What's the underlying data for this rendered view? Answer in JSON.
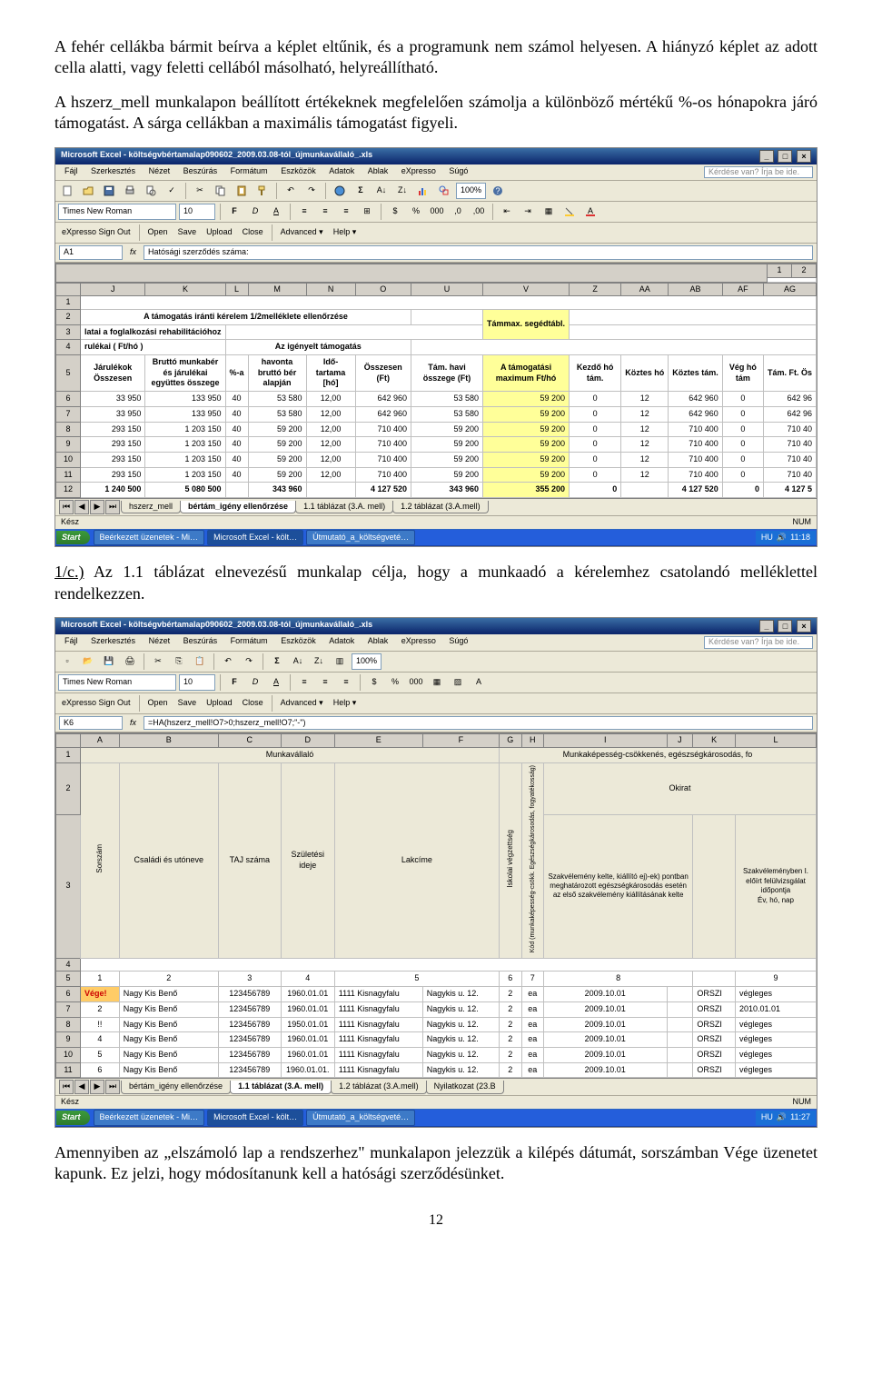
{
  "para1": "A fehér cellákba bármit beírva a képlet eltűnik, és a programunk nem számol helyesen. A hiányzó képlet az adott cella alatti, vagy feletti cellából másolható, helyreállítható.",
  "para2": "A hszerz_mell munkalapon beállított értékeknek megfelelően számolja a különböző mértékű %-os hónapokra járó támogatást. A sárga cellákban a maximális támogatást figyeli.",
  "para3_prefix": "1/c.)",
  "para3_rest": " Az 1.1 táblázat elnevezésű munkalap célja, hogy a munkaadó a kérelemhez csatolandó melléklettel rendelkezzen.",
  "para4": "Amennyiben az „elszámoló lap a rendszerhez\" munkalapon jelezzük a kilépés dátumát, sorszámban Vége üzenetet kapunk. Ez jelzi, hogy módosítanunk kell a hatósági szerződésünket.",
  "pageNum": "12",
  "ex1": {
    "title": "Microsoft Excel - költségvbértamalap090602_2009.03.08-tól_újmunkavállaló_.xls",
    "helpHint": "Kérdése van? Írja be ide.",
    "menus": [
      "Fájl",
      "Szerkesztés",
      "Nézet",
      "Beszúrás",
      "Formátum",
      "Eszközök",
      "Adatok",
      "Ablak",
      "eXpresso",
      "Súgó"
    ],
    "font": "Times New Roman",
    "fontSize": "10",
    "zoom": "100%",
    "expresso": [
      "eXpresso Sign Out",
      "Open",
      "Save",
      "Upload",
      "Close",
      "Advanced ▾",
      "Help ▾"
    ],
    "nameBox": "A1",
    "formula": "Hatósági szerződés száma:",
    "cols": [
      "J",
      "K",
      "L",
      "M",
      "N",
      "O",
      "U",
      "V",
      "Z",
      "AA",
      "AB",
      "AF",
      "AG"
    ],
    "titleRow": "A támogatás iránti kérelem 1/2melléklete ellenőrzése",
    "hdrL1": "latai a foglalkozási rehabilitációhoz",
    "yellowBox1": "Támmax. segédtábl.",
    "hdrL2": "rulékai ( Ft/hó )",
    "hdrL2r": "Az igényelt támogatás",
    "h5": [
      "Járulékok Összesen",
      "Bruttó munkabér és járulékai együttes összege",
      "%-a",
      "havonta bruttó bér alapján",
      "Idő- tartama [hó]",
      "Összesen (Ft)",
      "Tám. havi összege (Ft)",
      "A támogatási maximum Ft/hó",
      "Kezdő hó tám.",
      "Köztes hó",
      "Köztes tám.",
      "Vég hó tám",
      "Tám. Ft. Ös"
    ],
    "rows": [
      [
        "33 950",
        "133 950",
        "40",
        "53 580",
        "12,00",
        "642 960",
        "53 580",
        "59 200",
        "0",
        "12",
        "642 960",
        "0",
        "642 96"
      ],
      [
        "33 950",
        "133 950",
        "40",
        "53 580",
        "12,00",
        "642 960",
        "53 580",
        "59 200",
        "0",
        "12",
        "642 960",
        "0",
        "642 96"
      ],
      [
        "293 150",
        "1 203 150",
        "40",
        "59 200",
        "12,00",
        "710 400",
        "59 200",
        "59 200",
        "0",
        "12",
        "710 400",
        "0",
        "710 40"
      ],
      [
        "293 150",
        "1 203 150",
        "40",
        "59 200",
        "12,00",
        "710 400",
        "59 200",
        "59 200",
        "0",
        "12",
        "710 400",
        "0",
        "710 40"
      ],
      [
        "293 150",
        "1 203 150",
        "40",
        "59 200",
        "12,00",
        "710 400",
        "59 200",
        "59 200",
        "0",
        "12",
        "710 400",
        "0",
        "710 40"
      ],
      [
        "293 150",
        "1 203 150",
        "40",
        "59 200",
        "12,00",
        "710 400",
        "59 200",
        "59 200",
        "0",
        "12",
        "710 400",
        "0",
        "710 40"
      ]
    ],
    "sumRow": [
      "1 240 500",
      "5 080 500",
      "",
      "343 960",
      "",
      "4 127 520",
      "343 960",
      "355 200",
      "0",
      "",
      "4 127 520",
      "0",
      "4 127 5"
    ],
    "tabs": [
      "hszerz_mell",
      "bértám_igény ellenőrzése",
      "1.1 táblázat (3.A. mell)",
      "1.2 táblázat (3.A.mell)"
    ],
    "activeTab": 1,
    "status": "Kész",
    "statusRight": "NUM",
    "taskbar": {
      "tasks": [
        "Beérkezett üzenetek - Mi…",
        "Microsoft Excel - költ…",
        "Útmutató_a_költségveté…"
      ],
      "time": "11:18",
      "lang": "HU"
    }
  },
  "ex2": {
    "title": "Microsoft Excel - költségvbértamalap090602_2009.03.08-tól_újmunkavállaló_.xls",
    "helpHint": "Kérdése van? Írja be ide.",
    "menus": [
      "Fájl",
      "Szerkesztés",
      "Nézet",
      "Beszúrás",
      "Formátum",
      "Eszközök",
      "Adatok",
      "Ablak",
      "eXpresso",
      "Súgó"
    ],
    "font": "Times New Roman",
    "fontSize": "10",
    "zoom": "100%",
    "expresso": [
      "eXpresso Sign Out",
      "Open",
      "Save",
      "Upload",
      "Close",
      "Advanced ▾",
      "Help ▾"
    ],
    "nameBox": "K6",
    "formula": "=HA(hszerz_mell!O7>0;hszerz_mell!O7;\"-\")",
    "cols": [
      "A",
      "B",
      "C",
      "D",
      "E",
      "F",
      "G",
      "H",
      "I",
      "J",
      "K",
      "L"
    ],
    "merge1a": "Munkavállaló",
    "merge1b": "Munkaképesség-csökkenés, egészségkárosodás, fo",
    "merge2": "Okirat",
    "h3": [
      "Sorszám",
      "Családi és utóneve",
      "TAJ száma",
      "Születési ideje",
      "Lakcíme",
      "Iskolai végzettség",
      "Kód (munkaképesség-csökk. Egészségkárosodás, fogyatékosság)",
      "Szakvélemény kelte, kiállító ej)-ek) pontban meghatározott egészségkárosodás esetén az első szakvélemény kiállításának kelte",
      "",
      "Szakvéleményben I. előírt felülvizsgálat időpontja"
    ],
    "h3b": [
      "",
      "",
      "",
      "",
      "",
      "",
      "",
      "",
      "",
      "Év, hó, nap"
    ],
    "n5": [
      "1",
      "2",
      "3",
      "4",
      "5",
      "6",
      "7",
      "8",
      "",
      "9"
    ],
    "rows": [
      [
        "Vége!",
        "Nagy Kis Benő",
        "123456789",
        "1960.01.01",
        "1111 Kisnagyfalu",
        "Nagykis u. 12.",
        "2",
        "ea",
        "2009.10.01",
        "ORSZI",
        "végleges"
      ],
      [
        "2",
        "Nagy Kis Benő",
        "123456789",
        "1960.01.01",
        "1111 Kisnagyfalu",
        "Nagykis u. 12.",
        "2",
        "ea",
        "2009.10.01",
        "ORSZI",
        "2010.01.01"
      ],
      [
        "!!",
        "Nagy Kis Benő",
        "123456789",
        "1950.01.01",
        "1111 Kisnagyfalu",
        "Nagykis u. 12.",
        "2",
        "ea",
        "2009.10.01",
        "ORSZI",
        "végleges"
      ],
      [
        "4",
        "Nagy Kis Benő",
        "123456789",
        "1960.01.01",
        "1111 Kisnagyfalu",
        "Nagykis u. 12.",
        "2",
        "ea",
        "2009.10.01",
        "ORSZI",
        "végleges"
      ],
      [
        "5",
        "Nagy Kis Benő",
        "123456789",
        "1960.01.01",
        "1111 Kisnagyfalu",
        "Nagykis u. 12.",
        "2",
        "ea",
        "2009.10.01",
        "ORSZI",
        "végleges"
      ],
      [
        "6",
        "Nagy Kis Benő",
        "123456789",
        "1960.01.01.",
        "1111 Kisnagyfalu",
        "Nagykis u. 12.",
        "2",
        "ea",
        "2009.10.01",
        "ORSZI",
        "végleges"
      ]
    ],
    "tabs": [
      "bértám_igény ellenőrzése",
      "1.1 táblázat (3.A. mell)",
      "1.2 táblázat (3.A.mell)",
      "Nyilatkozat (23.B"
    ],
    "activeTab": 1,
    "status": "Kész",
    "statusRight": "NUM",
    "taskbar": {
      "tasks": [
        "Beérkezett üzenetek - Mi…",
        "Microsoft Excel - költ…",
        "Útmutató_a_költségveté…"
      ],
      "time": "11:27",
      "lang": "HU"
    }
  }
}
